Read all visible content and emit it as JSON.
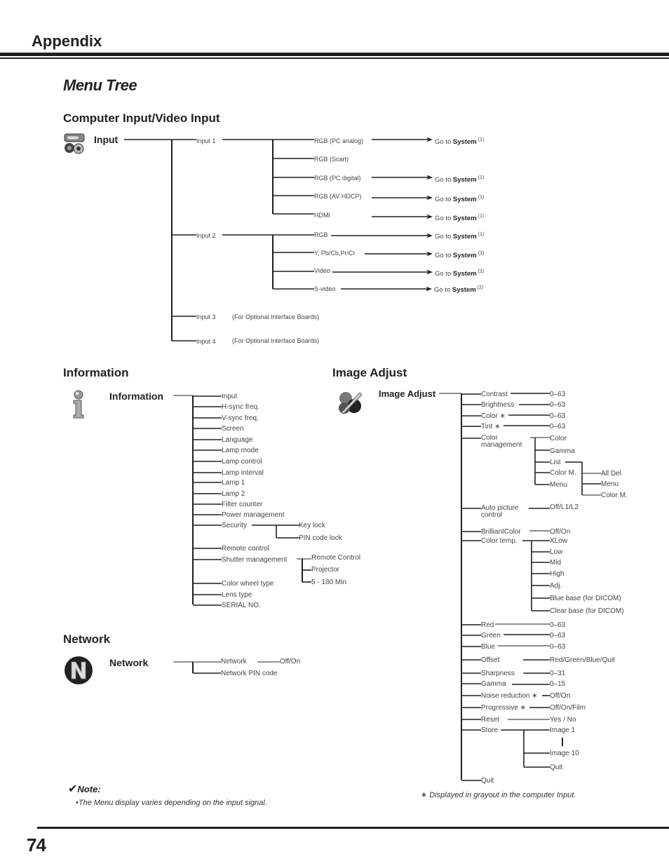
{
  "header": {
    "section": "Appendix",
    "title": "Menu Tree"
  },
  "computer_input": {
    "title": "Computer Input/Video Input",
    "root": "Input",
    "icon": "input-icon",
    "inputs": [
      {
        "label": "Input 1",
        "children": [
          {
            "label": "RGB (PC analog)",
            "goto": "Go to",
            "target": "System",
            "ref": "(1)"
          },
          {
            "label": "RGB (Scart)"
          },
          {
            "label": "RGB (PC digital)",
            "goto": "Go to",
            "target": "System",
            "ref": "(1)"
          },
          {
            "label": "RGB (AV HDCP)",
            "goto": "Go to",
            "target": "System",
            "ref": "(1)"
          },
          {
            "label": "HDMI",
            "goto": "Go to",
            "target": "System",
            "ref": "(1)"
          }
        ]
      },
      {
        "label": "Input 2",
        "children": [
          {
            "label": "RGB",
            "goto": "Go to",
            "target": "System",
            "ref": "(1)"
          },
          {
            "label": "Y, Pb/Cb,Pr/Cr",
            "goto": "Go to",
            "target": "System",
            "ref": "(3)"
          },
          {
            "label": "Video",
            "goto": "Go to",
            "target": "System",
            "ref": "(2)"
          },
          {
            "label": "S-video",
            "goto": "Go to",
            "target": "System",
            "ref": "(2)"
          }
        ]
      },
      {
        "label": "Input 3",
        "note": "(For Optional Interface Boards)"
      },
      {
        "label": "Input 4",
        "note": "(For Optional Interface Boards)"
      }
    ]
  },
  "information": {
    "title": "Information",
    "root": "Information",
    "icon": "info-icon",
    "items": [
      "Input",
      "H-sync freq.",
      "V-sync freq.",
      "Screen",
      "Language",
      "Lamp mode",
      "Lamp control",
      "Lamp interval",
      "Lamp 1",
      "Lamp 2",
      "Filter counter",
      "Power management",
      "Security",
      "Remote control",
      "Shutter management",
      "Color wheel type",
      "Lens type",
      "SERIAL NO."
    ],
    "security_children": [
      "Key lock",
      "PIN code lock"
    ],
    "shutter_children": [
      "Remote Control",
      "Projector",
      "5 - 180 Min"
    ]
  },
  "network": {
    "title": "Network",
    "root": "Network",
    "icon": "network-icon",
    "items": [
      {
        "label": "Network",
        "value": "Off/On"
      },
      {
        "label": "Network PIN code"
      }
    ]
  },
  "image_adjust": {
    "title": "Image Adjust",
    "root": "Image Adjust",
    "icon": "image-adjust-icon",
    "items": [
      {
        "label": "Contrast",
        "value": "0–63"
      },
      {
        "label": "Brightness",
        "value": "0–63"
      },
      {
        "label": "Color ∗",
        "value": "0–63"
      },
      {
        "label": "Tint ∗",
        "value": "0–63"
      },
      {
        "label": "Color management",
        "children": [
          "Color",
          "Gamma",
          "List",
          "Color M.",
          "Menu"
        ],
        "list_children": [
          "All Del",
          "Menu",
          "Color M."
        ]
      },
      {
        "label": "Auto picture control",
        "value": "Off/L1/L2"
      },
      {
        "label": "BrilliantColor",
        "value": "Off/On"
      },
      {
        "label": "Color temp.",
        "children": [
          "XLow",
          "Low",
          "Mid",
          "High",
          "Adj.",
          "Blue base (for DICOM)",
          "Clear base (for DICOM)"
        ]
      },
      {
        "label": "Red",
        "value": "0–63"
      },
      {
        "label": "Green",
        "value": "0–63"
      },
      {
        "label": "Blue",
        "value": "0–63"
      },
      {
        "label": "Offset",
        "value": "Red/Green/Blue/Quit"
      },
      {
        "label": "Sharpness",
        "value": "0–31"
      },
      {
        "label": "Gamma",
        "value": "0–15"
      },
      {
        "label": "Noise reduction ∗",
        "value": "Off/On"
      },
      {
        "label": "Progressive ∗",
        "value": "Off/On/Film"
      },
      {
        "label": "Reset",
        "value": "Yes / No"
      },
      {
        "label": "Store",
        "children": [
          "Image 1",
          "Image 10",
          "Quit"
        ]
      },
      {
        "label": "Quit"
      }
    ]
  },
  "notes": {
    "title": "Note:",
    "check_icon": "✔",
    "text": "•The Menu display varies depending on the input signal.",
    "star_note": "∗  Displayed in grayout in the computer Input."
  },
  "footer": {
    "page_number": "74"
  }
}
